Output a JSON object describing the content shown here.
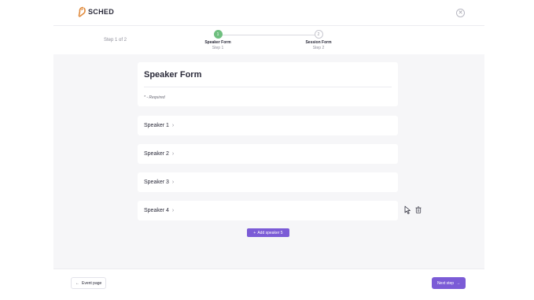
{
  "brand": {
    "name": "SCHED",
    "accent": "#7b5bd6",
    "success": "#6fbf7f"
  },
  "header": {
    "close_icon": "close-circle-icon"
  },
  "stepper": {
    "count_label": "Step 1 of 2",
    "steps": [
      {
        "number": "1",
        "name": "Speaker Form",
        "sub": "Step 1",
        "state": "active"
      },
      {
        "number": "2",
        "name": "Session Form",
        "sub": "Step 2",
        "state": "inactive"
      }
    ]
  },
  "form": {
    "title": "Speaker Form",
    "required_note": "* - Required"
  },
  "speakers": [
    {
      "label": "Speaker 1"
    },
    {
      "label": "Speaker 2"
    },
    {
      "label": "Speaker 3"
    },
    {
      "label": "Speaker 4"
    }
  ],
  "add_speaker": {
    "label": "Add speaker 5"
  },
  "footer": {
    "back_label": "Event page",
    "next_label": "Next step"
  }
}
